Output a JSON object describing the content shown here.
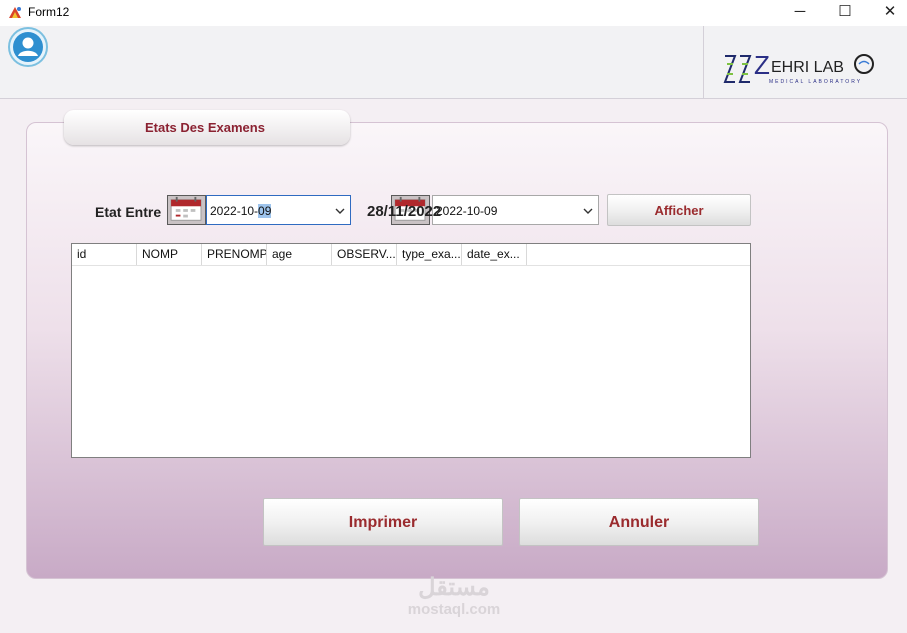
{
  "window": {
    "title": "Form12",
    "minimize_glyph": "─",
    "maximize_glyph": "☐",
    "close_glyph": "✕"
  },
  "header": {
    "logo_text": "EHRI LAB",
    "logo_letter": "Z",
    "logo_subtitle": "MEDICAL LABORATORY"
  },
  "panel": {
    "tab_label": "Etats Des  Examens",
    "between_label": "Etat Entre",
    "date_from": {
      "prefix": "2022-10-",
      "selected": "09"
    },
    "date_to": {
      "value": "2022-10-09"
    },
    "overlay_date": "28/11/2022",
    "afficher_label": "Afficher"
  },
  "grid": {
    "columns": [
      "id",
      "NOMP",
      "PRENOMP",
      "age",
      "OBSERV...",
      "type_exa...",
      "date_ex..."
    ]
  },
  "buttons": {
    "imprimer": "Imprimer",
    "annuler": "Annuler"
  },
  "watermark": {
    "arabic": "مستقل",
    "latin": "mostaql.com"
  },
  "colors": {
    "accent": "#9a2b2e",
    "focus_border": "#2f6bc1",
    "panel_bottom": "#c8aac6"
  }
}
